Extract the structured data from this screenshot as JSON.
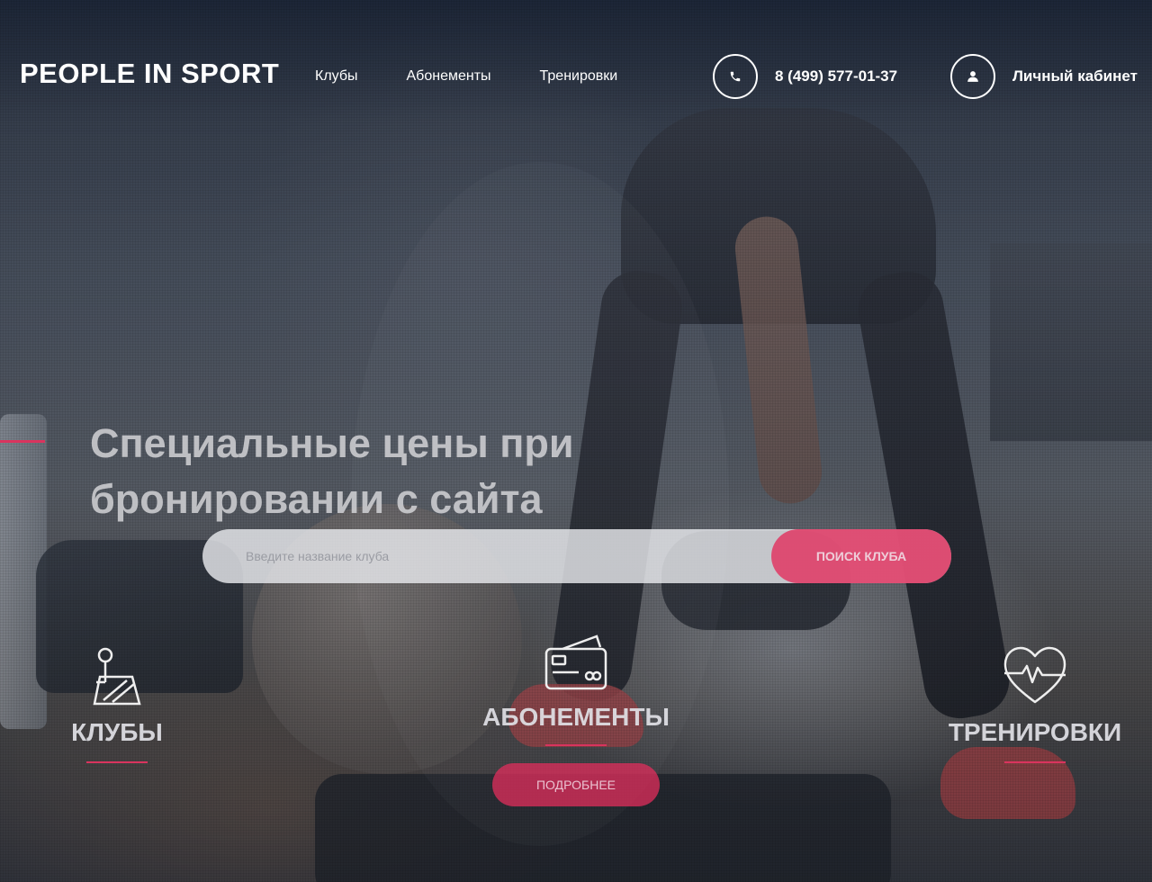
{
  "header": {
    "logo": "PEOPLE IN SPORT",
    "nav": [
      "Клубы",
      "Абонементы",
      "Тренировки"
    ],
    "phone": "8 (499) 577-01-37",
    "cabinet": "Личный кабинет"
  },
  "hero": {
    "title": "Специальные цены при бронировании с сайта",
    "search": {
      "placeholder": "Введите название клуба",
      "button": "ПОИСК КЛУБА"
    }
  },
  "features": {
    "clubs": "КЛУБЫ",
    "subscriptions": "АБОНЕМЕНТЫ",
    "trainings": "ТРЕНИРОВКИ",
    "more_button": "ПОДРОБНЕЕ"
  },
  "icons": {
    "phone": "phone-icon",
    "user": "user-icon",
    "clubs": "map-pin-icon",
    "subscriptions": "card-icon",
    "trainings": "heart-pulse-icon"
  },
  "colors": {
    "accent": "#d9345e",
    "overlay": "#182234"
  }
}
